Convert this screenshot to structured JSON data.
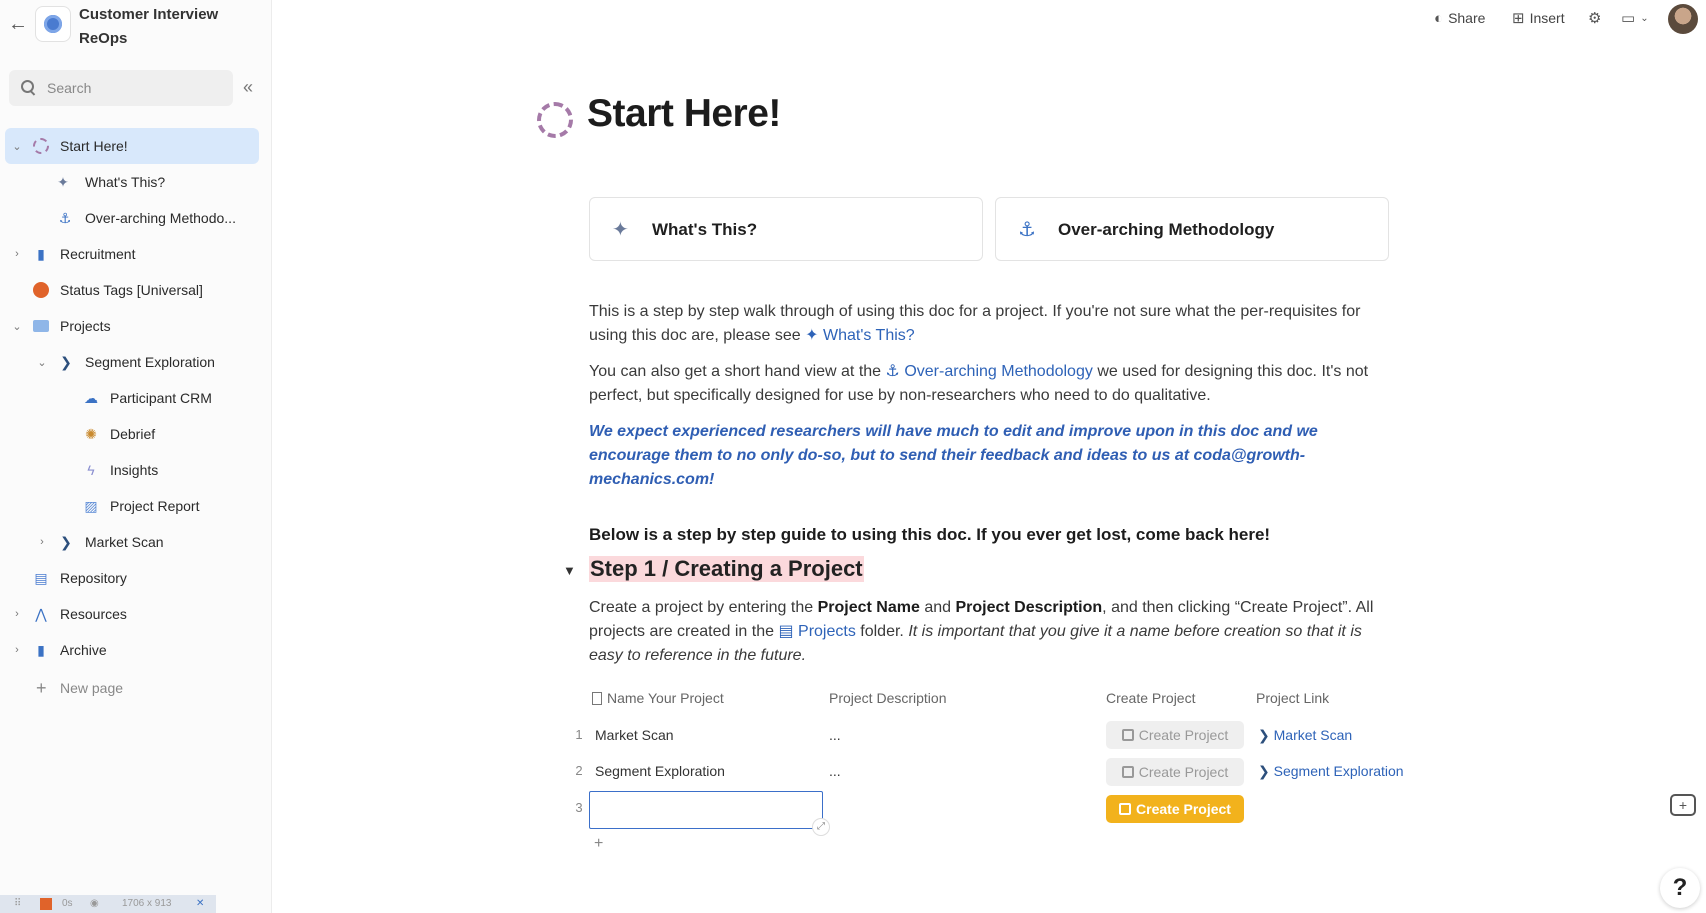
{
  "doc": {
    "title_line1": "Customer Interview",
    "title_line2": "ReOps"
  },
  "search": {
    "placeholder": "Search"
  },
  "sidebar": {
    "items": [
      {
        "label": "Start Here!",
        "icon": "dashed-circle-icon",
        "chevron": "⌄"
      },
      {
        "label": "What's This?",
        "icon": "satellite-icon"
      },
      {
        "label": "Over-arching Methodo...",
        "icon": "anchor-icon"
      },
      {
        "label": "Recruitment",
        "icon": "thermometer-icon",
        "chevron": "›"
      },
      {
        "label": "Status Tags [Universal]",
        "icon": "status-blob-icon"
      },
      {
        "label": "Projects",
        "icon": "folder-icon",
        "chevron": "⌄"
      },
      {
        "label": "Segment Exploration",
        "icon": "chevron-badge-icon",
        "chevron": "⌄"
      },
      {
        "label": "Participant CRM",
        "icon": "crm-icon"
      },
      {
        "label": "Debrief",
        "icon": "debrief-icon"
      },
      {
        "label": "Insights",
        "icon": "lightning-icon"
      },
      {
        "label": "Project Report",
        "icon": "report-icon"
      },
      {
        "label": "Market Scan",
        "icon": "chevron-badge-icon",
        "chevron": "›"
      },
      {
        "label": "Repository",
        "icon": "repository-icon"
      },
      {
        "label": "Resources",
        "icon": "resources-icon",
        "chevron": "›"
      },
      {
        "label": "Archive",
        "icon": "archive-icon",
        "chevron": "›"
      }
    ],
    "new_page": "New page"
  },
  "statusbar": {
    "time": "0s",
    "size": "1706 x 913"
  },
  "topbar": {
    "share": "Share",
    "insert": "Insert"
  },
  "page": {
    "title": "Start Here!",
    "cards": [
      {
        "label": "What's This?",
        "icon": "satellite-icon"
      },
      {
        "label": "Over-arching Methodology",
        "icon": "anchor-icon"
      }
    ],
    "p1_a": "This is a step by step walk through of using this doc for a project. If you're not sure what the per-requisites for using this doc are, please see",
    "p1_link": "What's This?",
    "p2_a": "You can also get a short hand view at the",
    "p2_link": "Over-arching Methodology",
    "p2_b": "we used for designing this doc. It's not perfect, but specifically designed for use by non-researchers who need to do qualitative.",
    "callout": "We expect experienced researchers will have much to edit and improve upon in this doc and we encourage them to no only do-so, but to send their feedback and ideas to us at coda@growth-mechanics.com!",
    "guide": "Below is a step by step guide to using this doc. If you ever get lost, come back here!",
    "step_heading": "Step 1 / Creating a Project",
    "step_a": "Create a project by entering the",
    "step_b1": "Project Name",
    "step_c": "and",
    "step_b2": "Project Description",
    "step_d": ", and then clicking “Create Project”. All projects are created in the",
    "step_link": "Projects",
    "step_e": "folder.",
    "step_italic": "It is important that you give it a name before creation so that it is easy to reference in the future."
  },
  "table": {
    "headers": [
      "Name Your Project",
      "Project Description",
      "Create Project",
      "Project Link"
    ],
    "rows": [
      {
        "num": "1",
        "name": "Market Scan",
        "desc": "...",
        "button": "Create Project",
        "link": "Market Scan"
      },
      {
        "num": "2",
        "name": "Segment Exploration",
        "desc": "...",
        "button": "Create Project",
        "link": "Segment Exploration"
      },
      {
        "num": "3",
        "name": "",
        "desc": "",
        "button": "Create Project",
        "link": ""
      }
    ]
  },
  "colors": {
    "accent": "#2e63b8",
    "active_nav": "#d8e8fb",
    "create_button": "#f2b21c",
    "step_highlight": "#fbd9dc"
  }
}
